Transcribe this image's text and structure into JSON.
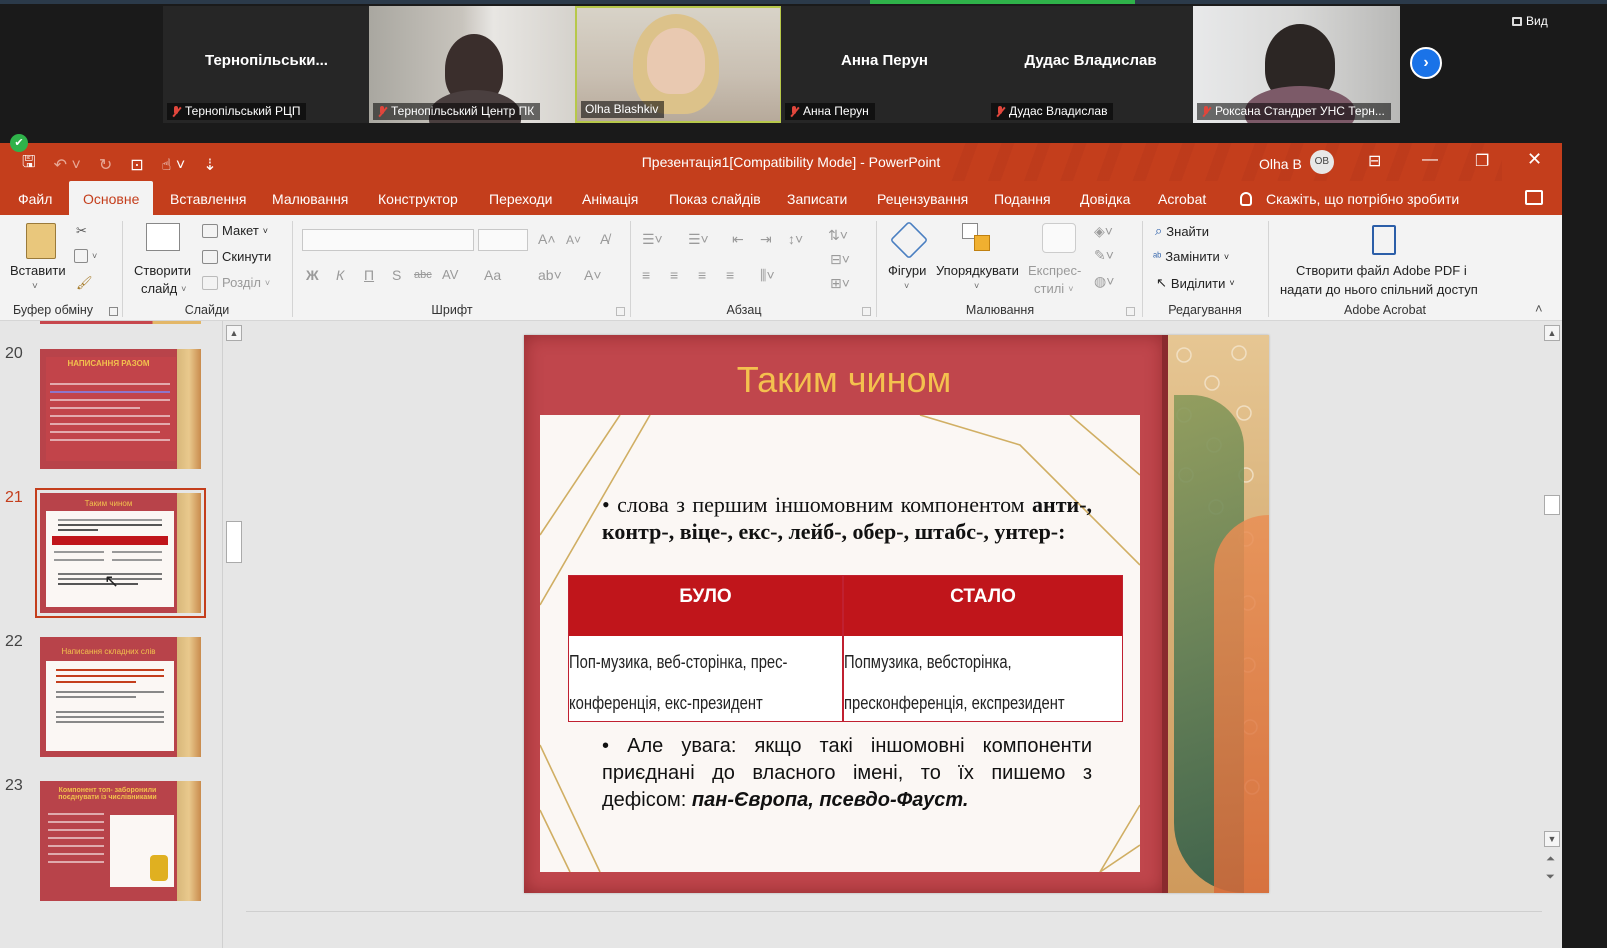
{
  "zoom": {
    "participants": [
      {
        "big_name": "Тернопільськи...",
        "label": "Тернопільський РЦП",
        "video": false
      },
      {
        "big_name": "",
        "label": "Тернопільський Центр ПК",
        "video": true
      },
      {
        "big_name": "",
        "label": "Olha Blashkiv",
        "video": true
      },
      {
        "big_name": "Анна Перун",
        "label": "Анна Перун",
        "video": false
      },
      {
        "big_name": "Дудас Владислав",
        "label": "Дудас Владислав",
        "video": false
      },
      {
        "big_name": "",
        "label": "Роксана Стандрет УНС Терн...",
        "video": true
      }
    ],
    "view_label": "Вид",
    "next_icon": "chevron-right-icon"
  },
  "powerpoint": {
    "window_title": "Презентація1[Compatibility Mode]  -  PowerPoint",
    "user_name": "Olha B",
    "user_initials": "OB",
    "tabs": [
      "Файл",
      "Основне",
      "Вставлення",
      "Малювання",
      "Конструктор",
      "Переходи",
      "Анімація",
      "Показ слайдів",
      "Записати",
      "Рецензування",
      "Подання",
      "Довідка",
      "Acrobat"
    ],
    "active_tab": "Основне",
    "tell_me": "Скажіть, що потрібно зробити",
    "ribbon": {
      "paste": "Вставити",
      "new_slide_1": "Створити",
      "new_slide_2": "слайд",
      "layout": "Макет",
      "reset": "Скинути",
      "section": "Розділ",
      "shapes": "Фігури",
      "arrange": "Упорядкувати",
      "quick_styles_1": "Експрес-",
      "quick_styles_2": "стилі",
      "find": "Знайти",
      "replace": "Замінити",
      "select": "Виділити",
      "acrobat_1": "Створити файл Adobe PDF і",
      "acrobat_2": "надати до нього спільний доступ",
      "groups": {
        "clipboard": "Буфер обміну",
        "slides": "Слайди",
        "font": "Шрифт",
        "paragraph": "Абзац",
        "drawing": "Малювання",
        "editing": "Редагування",
        "acrobat": "Adobe Acrobat"
      },
      "font_buttons": [
        "Ж",
        "К",
        "П",
        "S",
        "abc",
        "AV",
        "Aa"
      ]
    },
    "thumbnails": [
      {
        "num": "20",
        "title": "НАПИСАННЯ РАЗОМ"
      },
      {
        "num": "21",
        "title": "Таким чином"
      },
      {
        "num": "22",
        "title": "Написання складних слів"
      },
      {
        "num": "23",
        "title": "Компонент топ- заборонили поєднувати із числівниками"
      }
    ],
    "slide": {
      "title": "Таким чином",
      "bullet1_plain": "• слова з першим іншомовним компонентом",
      "bullet1_bold": "анти-, контр-, віце-, екс-, лейб-, обер-, штабс-, унтер-:",
      "table": {
        "headers": [
          "БУЛО",
          "СТАЛО"
        ],
        "col1": [
          "Поп-музика, веб-сторінка, прес-",
          "конференція, екс-президент"
        ],
        "col2": [
          "Попмузика, вебсторінка,",
          "пресконференція, експрезидент"
        ]
      },
      "bullet2_plain": "• Але увага: якщо такі іншомовні компоненти приєднані до власного імені, то їх пишемо з дефісом:",
      "bullet2_italic": "пан-Європа, псевдо-Фауст."
    }
  }
}
